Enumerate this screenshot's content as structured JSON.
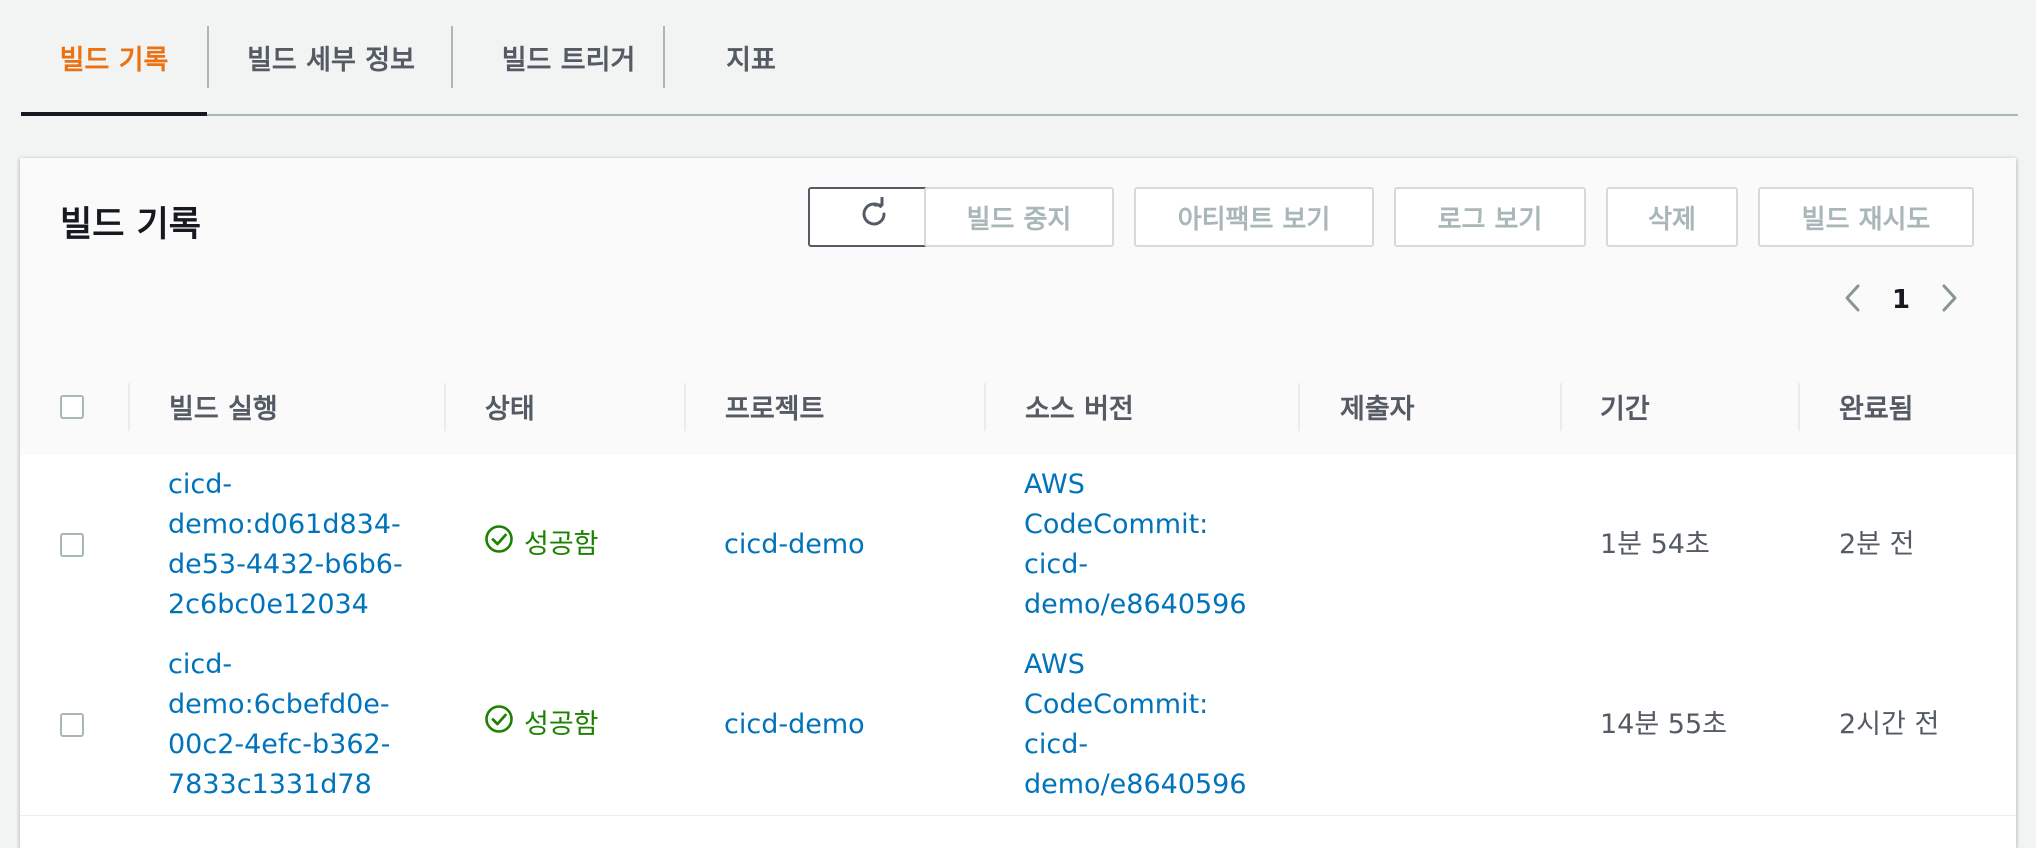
{
  "tabs": [
    {
      "label": "빌드 기록",
      "active": true
    },
    {
      "label": "빌드 세부 정보",
      "active": false
    },
    {
      "label": "빌드 트리거",
      "active": false
    },
    {
      "label": "지표",
      "active": false
    }
  ],
  "panel": {
    "title": "빌드 기록",
    "buttons": {
      "refresh_icon": "refresh-icon",
      "stop": "빌드 중지",
      "artifacts": "아티팩트 보기",
      "logs": "로그 보기",
      "delete": "삭제",
      "retry": "빌드 재시도"
    },
    "pagination": {
      "current_page": "1"
    }
  },
  "table": {
    "columns": [
      "빌드 실행",
      "상태",
      "프로젝트",
      "소스 버전",
      "제출자",
      "기간",
      "완료됨"
    ],
    "rows": [
      {
        "build_run": "cicd-\ndemo:d061d834-\nde53-4432-b6b6-\n2c6bc0e12034",
        "status": "성공함",
        "project": "cicd-demo",
        "source_version": "AWS\nCodeCommit:\ncicd-\ndemo/e8640596",
        "submitter": "",
        "duration": "1분 54초",
        "completed": "2분 전"
      },
      {
        "build_run": "cicd-\ndemo:6cbefd0e-\n00c2-4efc-b362-\n7833c1331d78",
        "status": "성공함",
        "project": "cicd-demo",
        "source_version": "AWS\nCodeCommit:\ncicd-\ndemo/e8640596",
        "submitter": "",
        "duration": "14분 55초",
        "completed": "2시간 전"
      }
    ]
  },
  "colors": {
    "accent": "#ec7211",
    "link": "#0073bb",
    "success": "#1d8102"
  }
}
